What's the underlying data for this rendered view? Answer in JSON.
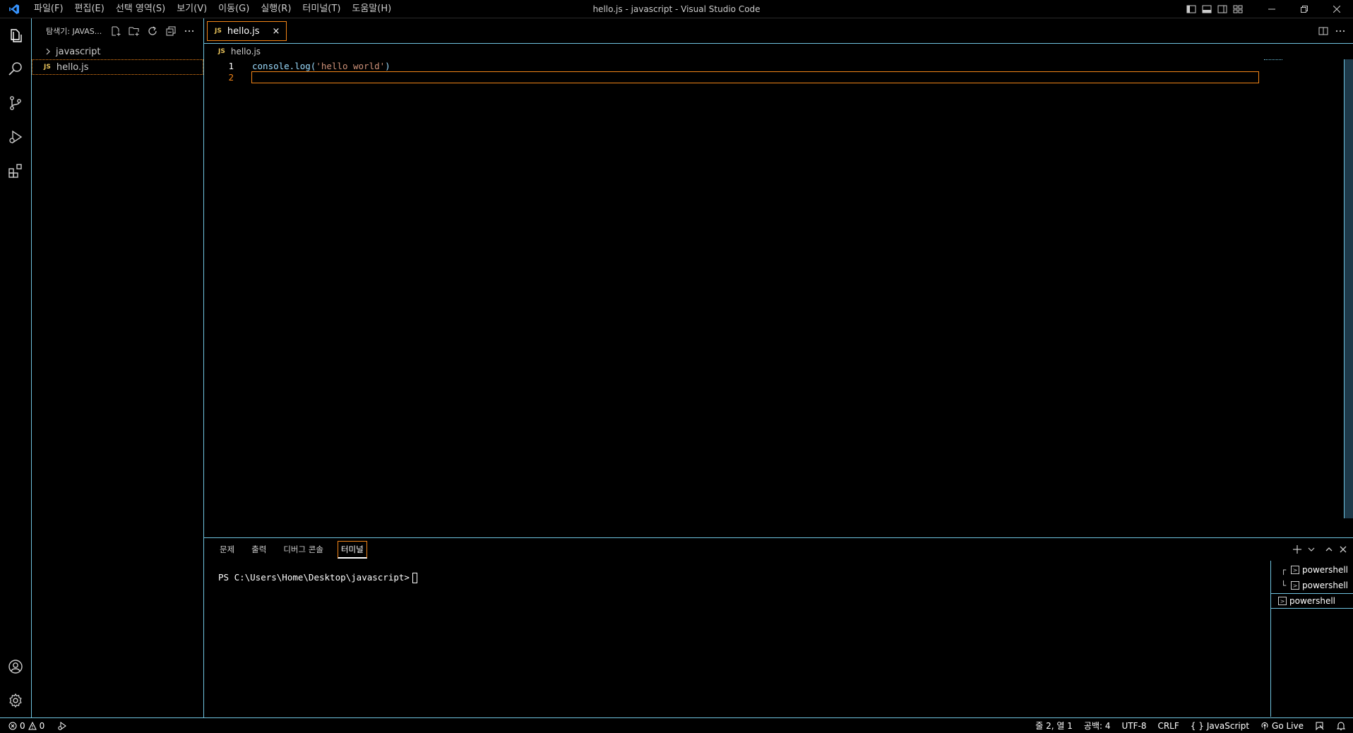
{
  "titlebar": {
    "window_title": "hello.js - javascript - Visual Studio Code",
    "menu": [
      "파일(F)",
      "편집(E)",
      "선택 영역(S)",
      "보기(V)",
      "이동(G)",
      "실행(R)",
      "터미널(T)",
      "도움말(H)"
    ],
    "accent_color": "#3794ff"
  },
  "sidebar": {
    "title": "탐색기: JAVAS...",
    "folder": "javascript",
    "file": "hello.js",
    "file_badge": "JS"
  },
  "editor": {
    "tab_label": "hello.js",
    "tab_badge": "JS",
    "tab_close": "×",
    "breadcrumb": "hello.js",
    "breadcrumb_badge": "JS",
    "lines": [
      {
        "number": "1",
        "code_prefix": "console.log(",
        "code_string": "'hello world'",
        "code_suffix": ")"
      },
      {
        "number": "2",
        "code_prefix": "",
        "code_string": "",
        "code_suffix": ""
      }
    ],
    "colors": {
      "text": "#9cdcfe",
      "string": "#ce9178",
      "active_line_number": "#f38518"
    }
  },
  "panel": {
    "tabs": [
      "문제",
      "출력",
      "디버그 콘솔",
      "터미널"
    ],
    "active_tab": "터미널",
    "prompt": "PS C:\\Users\\Home\\Desktop\\javascript>",
    "terminals": [
      "powershell",
      "powershell",
      "powershell"
    ]
  },
  "statusbar": {
    "errors": "0",
    "warnings": "0",
    "position": "줄 2, 열 1",
    "spaces": "공백: 4",
    "encoding": "UTF-8",
    "eol": "CRLF",
    "language": "JavaScript",
    "language_icon": "{ }",
    "go_live": "Go Live"
  },
  "theme": {
    "border_color": "#6fc3df",
    "focus_color": "#f38518",
    "background": "#000000"
  }
}
